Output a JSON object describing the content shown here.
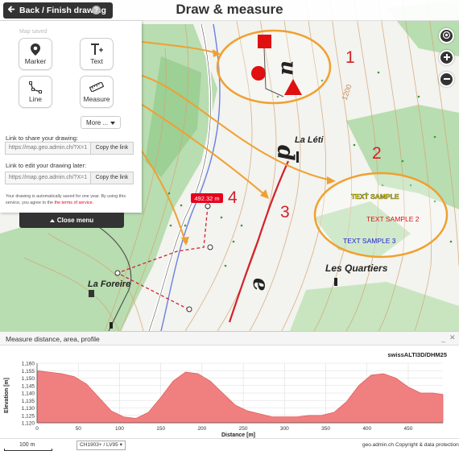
{
  "header": {
    "back_button_label": "Back / Finish drawing",
    "help_icon_glyph": "?",
    "title": "Draw & measure"
  },
  "panel": {
    "map_saved": "Map saved",
    "tools": [
      {
        "label": "Marker",
        "icon": "marker-icon"
      },
      {
        "label": "Text",
        "icon": "text-icon"
      },
      {
        "label": "Line",
        "icon": "line-icon"
      },
      {
        "label": "Measure",
        "icon": "ruler-icon"
      }
    ],
    "more_label": "More ...",
    "share_label": "Link to share your drawing:",
    "share_url": "https://map.geo.admin.ch/?X=1",
    "edit_label": "Link to edit your drawing later:",
    "edit_url": "https://map.geo.admin.ch/?X=1",
    "copy_label": "Copy the link",
    "save_note": "Your drawing is automatically saved for one year. By using this service, you agree to the",
    "terms_link": "the terms of service",
    "save_note_end": "."
  },
  "close_menu_label": "Close menu",
  "map": {
    "annotations": [
      "1",
      "2",
      "3",
      "4",
      "5"
    ],
    "place_labels": [
      "La Léti",
      "La Foreire",
      "Les Quartiers"
    ],
    "map_letters": [
      "u",
      "d",
      "e"
    ],
    "contour_label": "1200",
    "text_samples": [
      "TEXT SAMPLE",
      "TEXT SAMPLE 2",
      "TEXT SAMPLE 3"
    ],
    "measure_tooltip": "492.32 m",
    "colors": {
      "annotation": "#d2222d",
      "arrow": "#f0a030",
      "forest": "#a8d8a0",
      "contour": "#cf9a66"
    }
  },
  "controls": [
    "geolocate-icon",
    "zoom-in-icon",
    "zoom-out-icon"
  ],
  "measure_panel": {
    "title": "Measure distance, area, profile",
    "minimize_glyph": "_",
    "close_glyph": "✕"
  },
  "chart_data": {
    "type": "area",
    "title": "",
    "source_label": "swissALTI3D/DHM25",
    "xlabel": "Distance [m]",
    "ylabel": "Elevation [m]",
    "xlim": [
      0,
      492
    ],
    "ylim": [
      1120,
      1160
    ],
    "x_ticks": [
      0,
      50,
      100,
      150,
      200,
      250,
      300,
      350,
      400,
      450
    ],
    "y_ticks": [
      1120,
      1125,
      1130,
      1135,
      1140,
      1145,
      1150,
      1155,
      1160
    ],
    "fill_color": "#f08080",
    "grid": true,
    "series": [
      {
        "x": [
          0,
          15,
          30,
          45,
          60,
          75,
          90,
          105,
          120,
          135,
          150,
          165,
          180,
          195,
          210,
          225,
          240,
          255,
          270,
          285,
          300,
          315,
          330,
          345,
          360,
          375,
          390,
          405,
          420,
          435,
          450,
          465,
          480,
          492
        ],
        "values": [
          1155,
          1154,
          1153,
          1151,
          1146,
          1137,
          1128,
          1124,
          1123,
          1127,
          1137,
          1148,
          1154,
          1153,
          1148,
          1140,
          1132,
          1128,
          1126,
          1124,
          1124,
          1124,
          1125,
          1125,
          1127,
          1134,
          1145,
          1152,
          1153,
          1150,
          1144,
          1140,
          1140,
          1139
        ]
      }
    ]
  },
  "bottom": {
    "scale_label": "100 m",
    "projection": "CH1903+ / LV95",
    "geo_link": "geo.admin.ch",
    "copyright": "Copyright & data protection"
  }
}
